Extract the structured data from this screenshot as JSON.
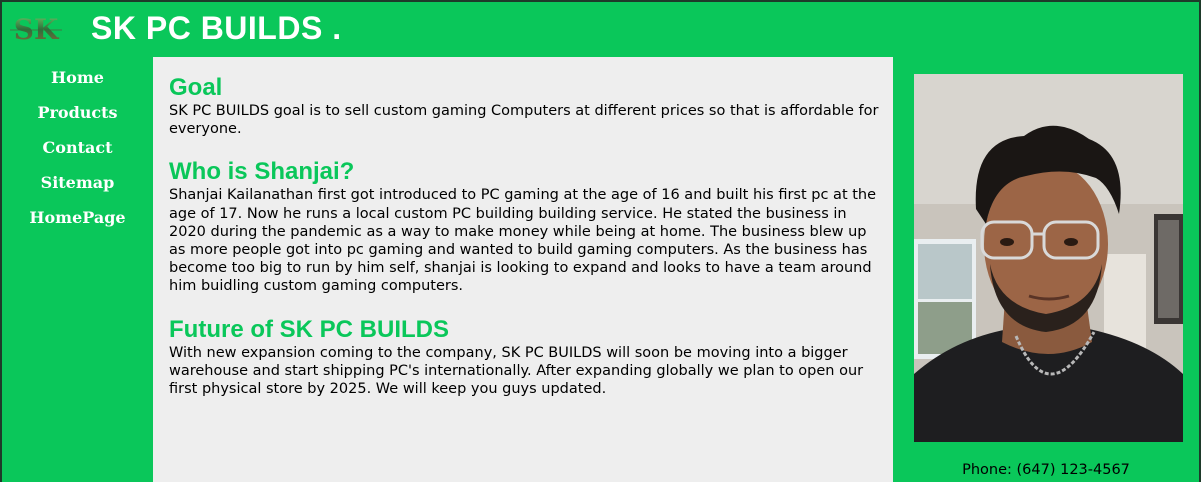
{
  "header": {
    "logo_text": "SK",
    "title": "SK PC BUILDS ."
  },
  "nav": {
    "items": [
      {
        "label": "Home"
      },
      {
        "label": "Products"
      },
      {
        "label": "Contact"
      },
      {
        "label": "Sitemap"
      },
      {
        "label": "HomePage"
      }
    ]
  },
  "main": {
    "sections": [
      {
        "heading": "Goal",
        "body": "SK PC BUILDS goal is to sell custom gaming Computers at different prices so that is affordable for everyone."
      },
      {
        "heading": "Who is Shanjai?",
        "body": "Shanjai Kailanathan first got introduced to PC gaming at the age of 16 and built his first pc at the age of 17. Now he runs a local custom PC building building service. He stated the business in 2020 during the pandemic as a way to make money while being at home. The business blew up as more people got into pc gaming and wanted to build gaming computers. As the business has become too big to run by him self, shanjai is looking to expand and looks to have a team around him buidling custom gaming computers."
      },
      {
        "heading": "Future of SK PC BUILDS",
        "body": "With new expansion coming to the company, SK PC BUILDS will soon be moving into a bigger warehouse and start shipping PC's internationally. After expanding globally we plan to open our first physical store by 2025. We will keep you guys updated."
      }
    ]
  },
  "aside": {
    "phone": "Phone: (647) 123-4567"
  },
  "colors": {
    "brand_green": "#0ac75a",
    "content_bg": "#eeeeee"
  }
}
